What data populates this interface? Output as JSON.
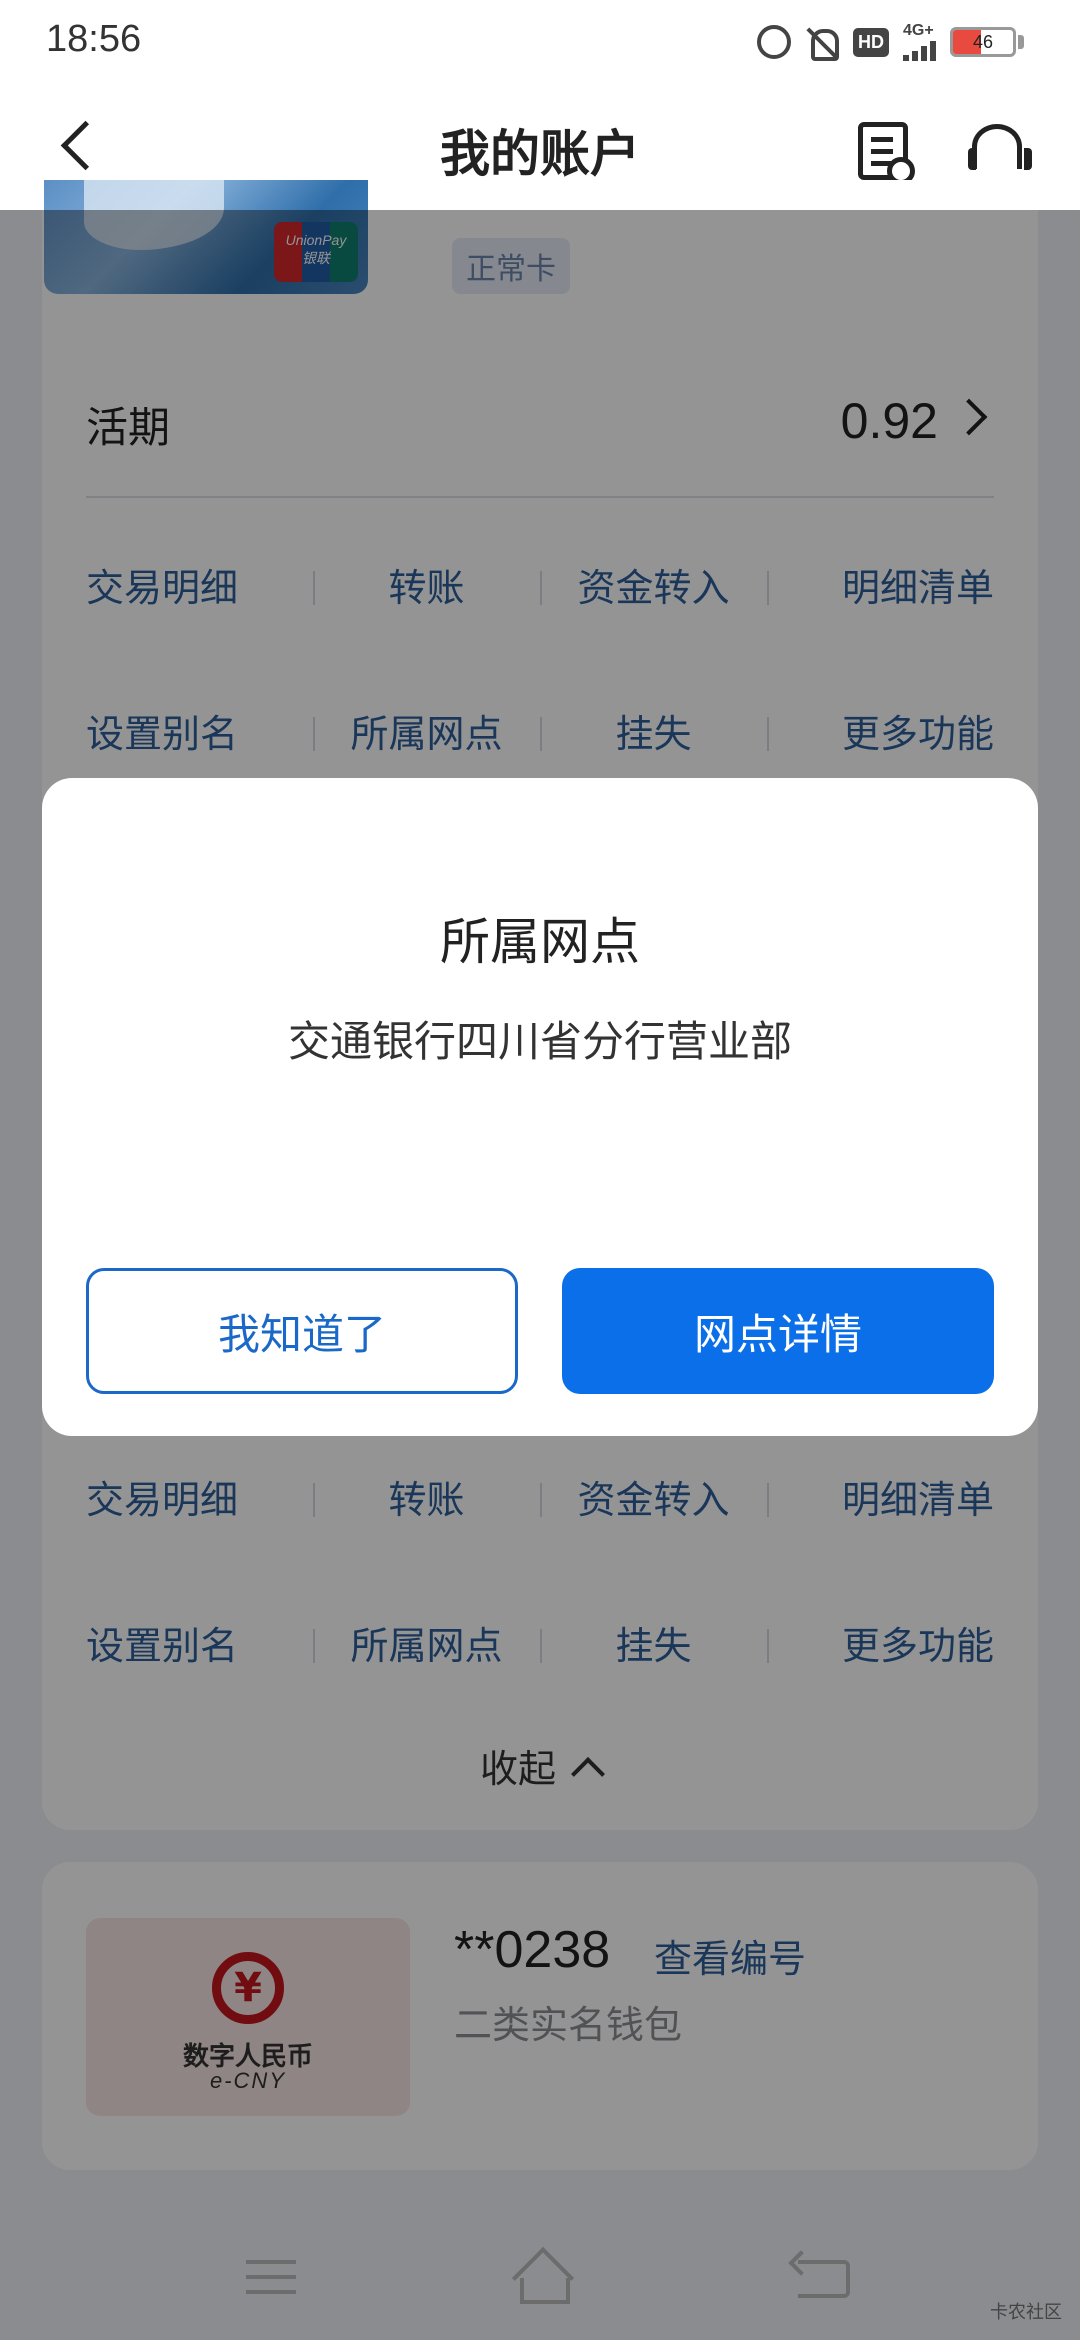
{
  "status_bar": {
    "time": "18:56",
    "hd": "HD",
    "network": "4G+",
    "battery": "46",
    "battery_fraction": 0.46
  },
  "header": {
    "title": "我的账户"
  },
  "account_card": {
    "status": "正常卡",
    "unionpay_label": "UnionPay 银联"
  },
  "balance": {
    "label": "活期",
    "value": "0.92"
  },
  "functions_row1": [
    "交易明细",
    "转账",
    "资金转入",
    "明细清单"
  ],
  "functions_row2": [
    "设置别名",
    "所属网点",
    "挂失",
    "更多功能"
  ],
  "collapse_label": "收起",
  "wallet": {
    "emblem": "¥",
    "logo_cn": "数字人民币",
    "logo_en": "e-CNY",
    "number": "**0238",
    "view_number": "查看编号",
    "type": "二类实名钱包"
  },
  "dialog": {
    "title": "所属网点",
    "message": "交通银行四川省分行营业部",
    "cancel": "我知道了",
    "confirm": "网点详情"
  },
  "watermark": "卡农社区",
  "colors": {
    "accent": "#0a6fe8",
    "link": "#2d5f9a",
    "overlay": "rgba(0,0,0,0.42)"
  }
}
